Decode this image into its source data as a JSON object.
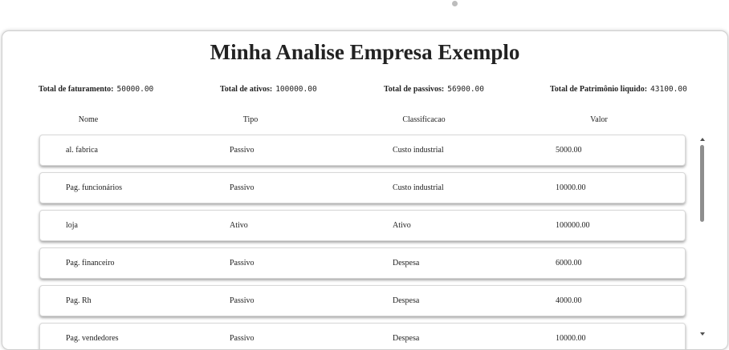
{
  "page": {
    "title": "Minha Analise Empresa Exemplo"
  },
  "totals": [
    {
      "label": "Total de faturamento:",
      "value": "50000.00"
    },
    {
      "label": "Total de ativos:",
      "value": "100000.00"
    },
    {
      "label": "Total de passivos:",
      "value": "56900.00"
    },
    {
      "label": "Total de Patrimônio liquido:",
      "value": "43100.00"
    }
  ],
  "table": {
    "headers": [
      "Nome",
      "Tipo",
      "Classificacao",
      "Valor"
    ],
    "rows": [
      {
        "nome": "al. fabrica",
        "tipo": "Passivo",
        "classificacao": "Custo industrial",
        "valor": "5000.00"
      },
      {
        "nome": "Pag. funcionários",
        "tipo": "Passivo",
        "classificacao": "Custo industrial",
        "valor": "10000.00"
      },
      {
        "nome": "loja",
        "tipo": "Ativo",
        "classificacao": "Ativo",
        "valor": "100000.00"
      },
      {
        "nome": "Pag. financeiro",
        "tipo": "Passivo",
        "classificacao": "Despesa",
        "valor": "6000.00"
      },
      {
        "nome": "Pag. Rh",
        "tipo": "Passivo",
        "classificacao": "Despesa",
        "valor": "4000.00"
      },
      {
        "nome": "Pag. vendedores",
        "tipo": "Passivo",
        "classificacao": "Despesa",
        "valor": "10000.00"
      }
    ]
  }
}
